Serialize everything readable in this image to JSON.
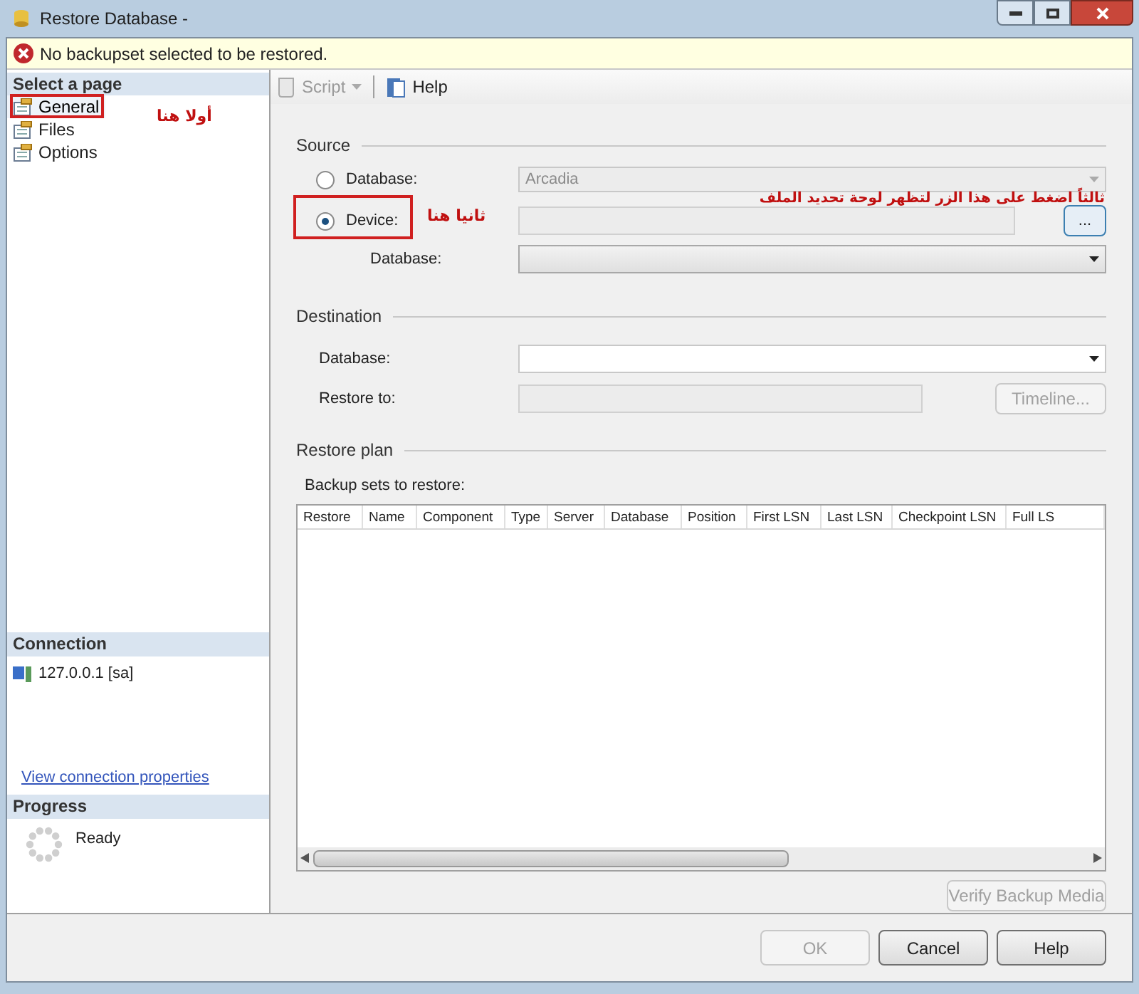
{
  "window": {
    "title": "Restore Database -"
  },
  "message_bar": {
    "text": "No backupset selected to be restored."
  },
  "sidebar": {
    "heading": "Select a page",
    "items": [
      {
        "label": "General",
        "selected": true
      },
      {
        "label": "Files",
        "selected": false
      },
      {
        "label": "Options",
        "selected": false
      }
    ],
    "connection": {
      "heading": "Connection",
      "server": "127.0.0.1 [sa]",
      "link": "View connection properties"
    },
    "progress": {
      "heading": "Progress",
      "status": "Ready"
    }
  },
  "toolbar": {
    "items": [
      {
        "label": "Script",
        "disabled": true,
        "kind": "script"
      },
      {
        "label": "Help",
        "disabled": false,
        "kind": "help"
      }
    ]
  },
  "source": {
    "heading": "Source",
    "options": [
      {
        "label": "Database:",
        "selected": false,
        "value": "Arcadia",
        "disabled": true,
        "kind": "combo"
      },
      {
        "label": "Device:",
        "selected": true,
        "disabled": false,
        "kind": "browse",
        "button": "..."
      }
    ],
    "database_label": "Database:"
  },
  "destination": {
    "heading": "Destination",
    "database_label": "Database:",
    "restore_to_label": "Restore to:",
    "timeline_button": {
      "label": "Timeline...",
      "disabled": true
    }
  },
  "restore_plan": {
    "heading": "Restore plan",
    "table_label": "Backup sets to restore:",
    "columns": [
      "Restore",
      "Name",
      "Component",
      "Type",
      "Server",
      "Database",
      "Position",
      "First LSN",
      "Last LSN",
      "Checkpoint LSN",
      "Full LS"
    ],
    "verify_button": {
      "label": "Verify Backup Media",
      "disabled": true
    }
  },
  "buttons": [
    {
      "label": "OK",
      "disabled": true
    },
    {
      "label": "Cancel",
      "disabled": false
    },
    {
      "label": "Help",
      "disabled": false
    }
  ],
  "annotations": [
    {
      "text": "أولا هنا",
      "kind": "first"
    },
    {
      "text": "ثانيا هنا",
      "kind": "second"
    },
    {
      "text": "ثالثاً اضغط على هذا الزر لتظهر لوحة تحديد الملف",
      "kind": "third"
    }
  ]
}
